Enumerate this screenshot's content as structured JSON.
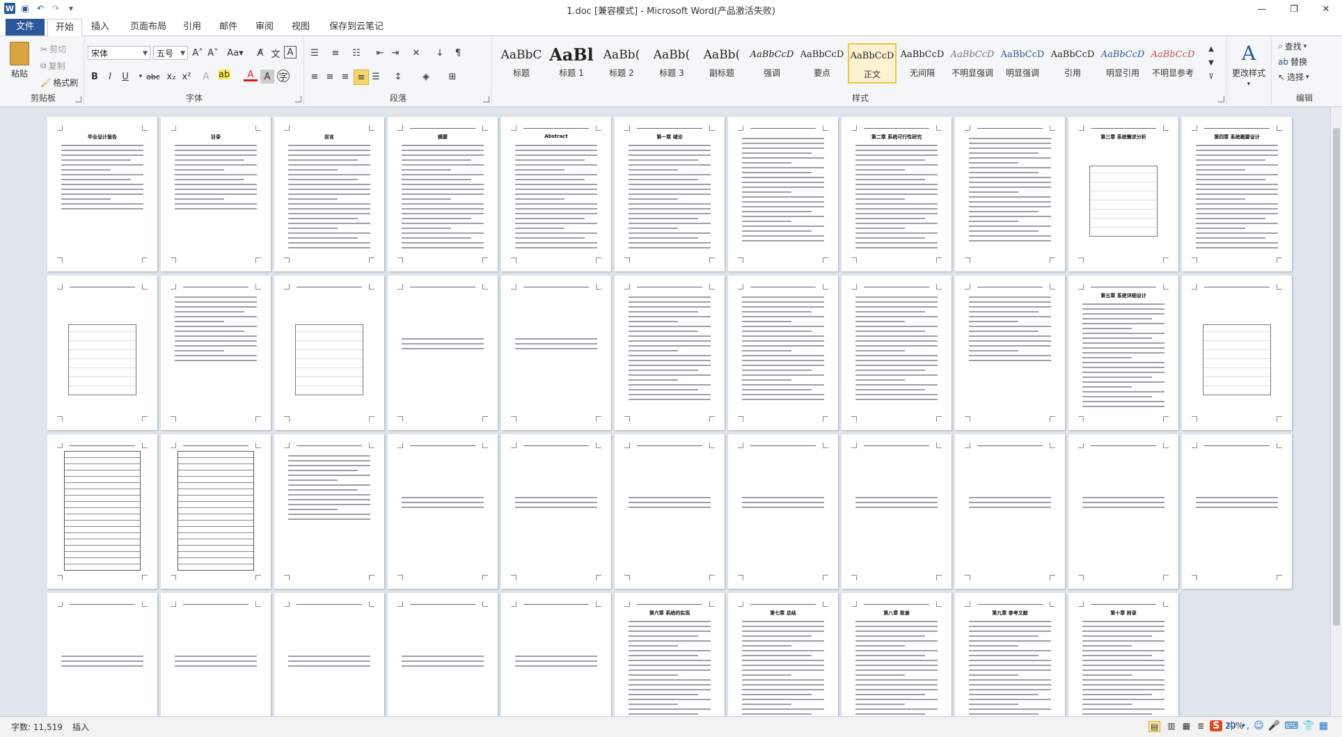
{
  "title_bar": {
    "title": "1.doc [兼容模式] - Microsoft Word(产品激活失败)",
    "qat_icons": [
      "word-logo-icon",
      "save-icon",
      "undo-icon",
      "redo-icon",
      "customize-icon"
    ],
    "window_buttons": [
      "minimize-icon",
      "restore-icon",
      "close-icon"
    ]
  },
  "tabs": [
    "文件",
    "开始",
    "插入",
    "页面布局",
    "引用",
    "邮件",
    "审阅",
    "视图",
    "保存到云笔记"
  ],
  "active_tab": "开始",
  "ribbon": {
    "clipboard": {
      "label": "剪贴板",
      "paste": "粘贴",
      "cut": "剪切",
      "copy": "复制",
      "format_painter": "格式刷"
    },
    "font": {
      "label": "字体",
      "font_name": "宋体",
      "font_size": "五号",
      "case": "Aa"
    },
    "paragraph": {
      "label": "段落"
    },
    "styles": {
      "label": "样式",
      "items": [
        {
          "sample": "AaBbC",
          "name": "标题"
        },
        {
          "sample": "AaBl",
          "name": "标题 1"
        },
        {
          "sample": "AaBb(",
          "name": "标题 2"
        },
        {
          "sample": "AaBb(",
          "name": "标题 3"
        },
        {
          "sample": "AaBb(",
          "name": "副标题"
        },
        {
          "sample": "AaBbCcD",
          "name": "强调"
        },
        {
          "sample": "AaBbCcD",
          "name": "要点"
        },
        {
          "sample": "AaBbCcD",
          "name": "正文"
        },
        {
          "sample": "AaBbCcD",
          "name": "无间隔"
        },
        {
          "sample": "AaBbCcD",
          "name": "不明显强调"
        },
        {
          "sample": "AaBbCcD",
          "name": "明显强调"
        },
        {
          "sample": "AaBbCcD",
          "name": "引用"
        },
        {
          "sample": "AaBbCcD",
          "name": "明显引用"
        },
        {
          "sample": "AaBbCcD",
          "name": "不明显参考"
        }
      ],
      "selected": "正文",
      "change_styles": "更改样式"
    },
    "editing": {
      "label": "编辑",
      "find": "查找",
      "replace": "替换",
      "select": "选择"
    }
  },
  "pages": {
    "row1_titles": [
      "毕业设计报告",
      "目录",
      "前言",
      "摘要",
      "Abstract",
      "第一章 绪论",
      "",
      "第二章 系统可行性研究",
      "",
      "第三章 系统需求分析",
      "第四章 系统概要设计"
    ],
    "row2_titles": [
      "",
      "",
      "",
      "",
      "",
      "",
      "",
      "",
      "",
      "第五章 系统详细设计",
      ""
    ],
    "row3_titles": [
      "",
      "",
      "",
      "",
      "",
      "",
      "",
      "",
      "",
      "",
      ""
    ],
    "row4_titles": [
      "",
      "",
      "",
      "",
      "",
      "第六章 系统的实现",
      "第七章 总结",
      "第八章 致谢",
      "第九章 参考文献",
      "第十章 附录"
    ]
  },
  "status": {
    "word_count": "字数: 11,519",
    "mode": "插入",
    "zoom": "20%",
    "ime_label": "中"
  }
}
